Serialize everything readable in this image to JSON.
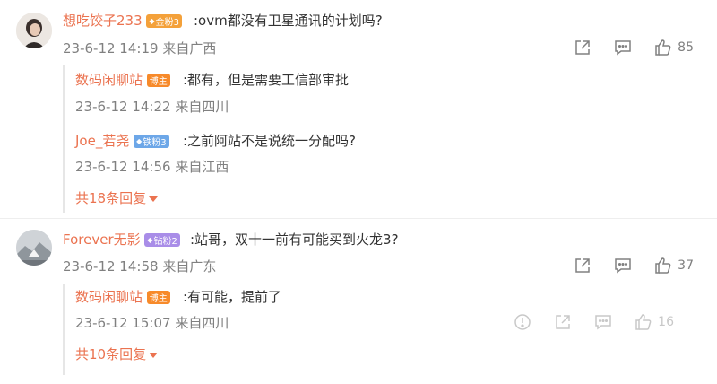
{
  "comments": [
    {
      "user": "想吃饺子233",
      "badge": "金粉3",
      "text": ":ovm都没有卫星通讯的计划吗?",
      "time": "23-6-12 14:19",
      "location": "来自广西",
      "likes": "85",
      "replies": [
        {
          "user": "数码闲聊站",
          "badge": "博主",
          "text": ":都有，但是需要工信部审批",
          "time": "23-6-12 14:22",
          "location": "来自四川"
        },
        {
          "user": "Joe_若尧",
          "badge": "铁粉3",
          "text": ":之前阿站不是说统一分配吗?",
          "time": "23-6-12 14:56",
          "location": "来自江西"
        }
      ],
      "more_label": "共18条回复"
    },
    {
      "user": "Forever无影",
      "badge": "钻粉2",
      "text": ":站哥，双十一前有可能买到火龙3?",
      "time": "23-6-12 14:58",
      "location": "来自广东",
      "likes": "37",
      "replies": [
        {
          "user": "数码闲聊站",
          "badge": "博主",
          "text": ":有可能，提前了",
          "time": "23-6-12 15:07",
          "location": "来自四川",
          "likes": "16"
        }
      ],
      "more_label": "共10条回复"
    }
  ],
  "icons": {
    "share": "share-icon",
    "comment": "comment-icon",
    "like": "like-icon",
    "report": "report-icon"
  },
  "colors": {
    "username": "#eb7350",
    "meta": "#808080",
    "gold_badge": "#f4a13a",
    "iron_badge": "#6da7e8",
    "drill_badge": "#a98de8",
    "host_badge": "#f78a2a"
  }
}
